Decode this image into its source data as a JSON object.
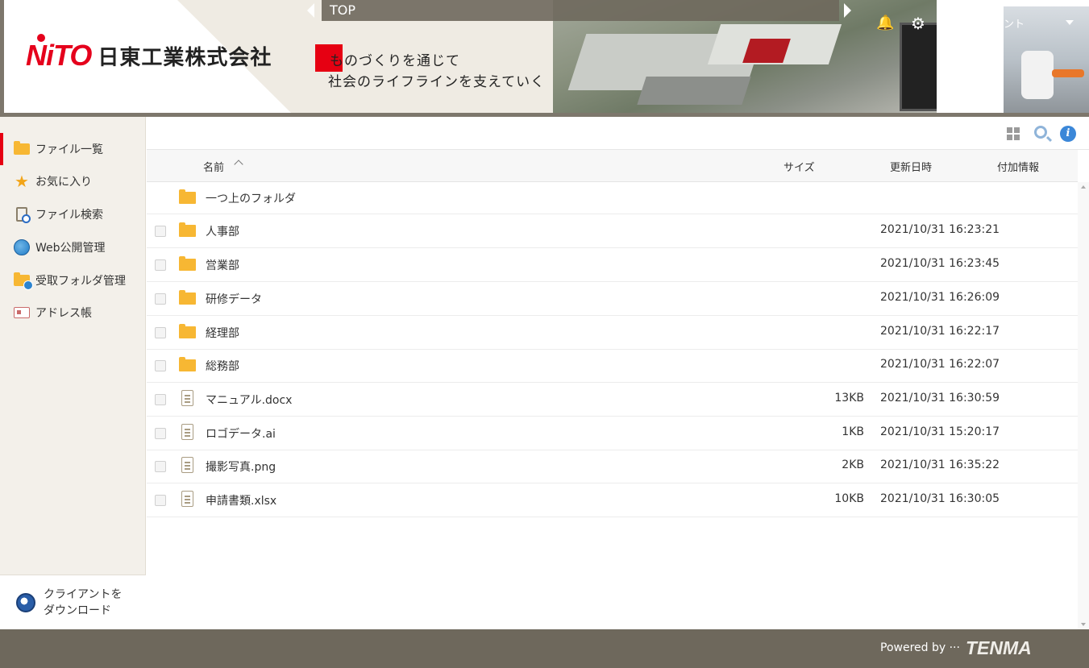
{
  "header": {
    "company_name": "日東工業株式会社",
    "logo_mark": "NiTO",
    "slogan_line1": "ものづくりを通じて",
    "slogan_line2": "社会のライフラインを支えていく",
    "nav_title": "TOP",
    "account_label": "マイアカウント",
    "icons": [
      "bell-icon",
      "gear-icon",
      "chevron-down-icon"
    ]
  },
  "sidebar": {
    "items": [
      {
        "label": "ファイル一覧",
        "icon": "folder-icon",
        "active": true
      },
      {
        "label": "お気に入り",
        "icon": "star-icon"
      },
      {
        "label": "ファイル検索",
        "icon": "file-search-icon"
      },
      {
        "label": "Web公開管理",
        "icon": "globe-icon"
      },
      {
        "label": "受取フォルダ管理",
        "icon": "folder-globe-icon"
      },
      {
        "label": "アドレス帳",
        "icon": "address-card-icon"
      }
    ],
    "download_line1": "クライアントを",
    "download_line2": "ダウンロード"
  },
  "toolbar": {
    "icons": [
      "grid-view-icon",
      "search-icon",
      "info-icon"
    ],
    "info_glyph": "i"
  },
  "table": {
    "columns": {
      "name": "名前",
      "size": "サイズ",
      "updated": "更新日時",
      "extra": "付加情報"
    },
    "sort": "name-ascending",
    "parent_row": "一つ上のフォルダ",
    "rows": [
      {
        "type": "folder",
        "name": "人事部",
        "size": "",
        "updated": "2021/10/31 16:23:21"
      },
      {
        "type": "folder",
        "name": "営業部",
        "size": "",
        "updated": "2021/10/31 16:23:45"
      },
      {
        "type": "folder",
        "name": "研修データ",
        "size": "",
        "updated": "2021/10/31 16:26:09"
      },
      {
        "type": "folder",
        "name": "経理部",
        "size": "",
        "updated": "2021/10/31 16:22:17"
      },
      {
        "type": "folder",
        "name": "総務部",
        "size": "",
        "updated": "2021/10/31 16:22:07"
      },
      {
        "type": "file",
        "name": "マニュアル.docx",
        "size": "13KB",
        "updated": "2021/10/31 16:30:59"
      },
      {
        "type": "file",
        "name": "ロゴデータ.ai",
        "size": "1KB",
        "updated": "2021/10/31 15:20:17"
      },
      {
        "type": "file",
        "name": "撮影写真.png",
        "size": "2KB",
        "updated": "2021/10/31 16:35:22"
      },
      {
        "type": "file",
        "name": "申請書類.xlsx",
        "size": "10KB",
        "updated": "2021/10/31 16:30:05"
      }
    ]
  },
  "footer": {
    "powered_by": "Powered by ···",
    "brand": "TENMA"
  },
  "colors": {
    "accent_red": "#e60012",
    "header_bar": "#6e685c",
    "folder_yellow": "#f7b733",
    "sidebar_bg": "#f3f0ea"
  }
}
